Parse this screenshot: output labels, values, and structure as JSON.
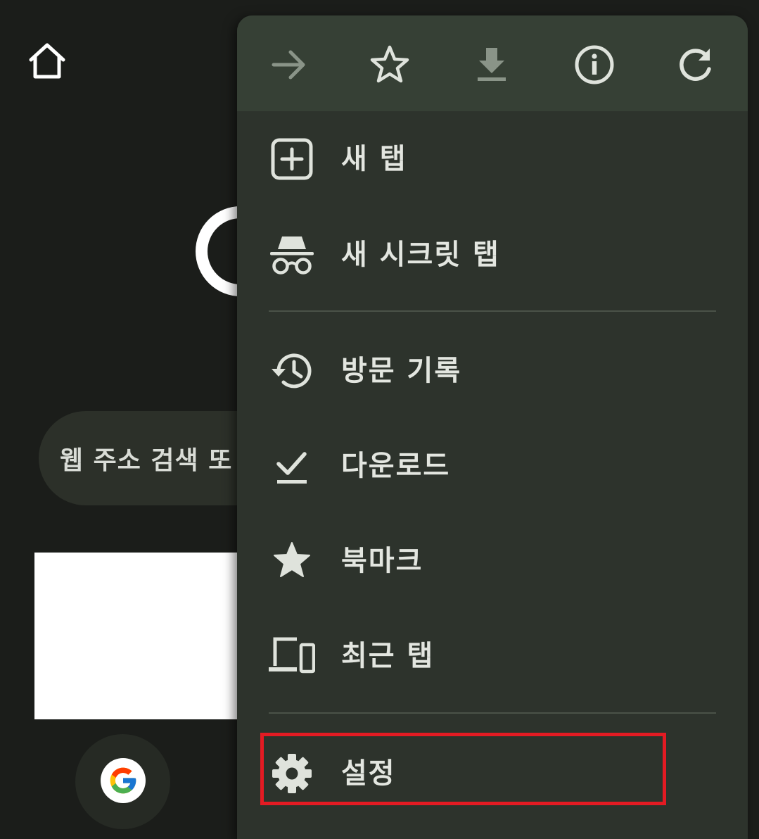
{
  "background": {
    "search_placeholder": "웹 주소 검색 또"
  },
  "toolbar": {
    "buttons": [
      {
        "name": "forward",
        "icon": "arrow-forward-icon",
        "enabled": false
      },
      {
        "name": "bookmark",
        "icon": "star-outline-icon",
        "enabled": true
      },
      {
        "name": "download",
        "icon": "download-icon",
        "enabled": false
      },
      {
        "name": "page-info",
        "icon": "info-icon",
        "enabled": true
      },
      {
        "name": "refresh",
        "icon": "refresh-icon",
        "enabled": true
      }
    ]
  },
  "menu": {
    "items": [
      {
        "label": "새 탭",
        "icon": "new-tab-icon"
      },
      {
        "label": "새 시크릿 탭",
        "icon": "incognito-icon"
      },
      {
        "label": "방문 기록",
        "icon": "history-icon"
      },
      {
        "label": "다운로드",
        "icon": "downloads-check-icon"
      },
      {
        "label": "북마크",
        "icon": "star-filled-icon"
      },
      {
        "label": "최근 탭",
        "icon": "devices-icon"
      },
      {
        "label": "설정",
        "icon": "gear-icon"
      }
    ],
    "highlighted_item": "설정"
  },
  "colors": {
    "page_background": "#1b1d1a",
    "menu_background": "#2d332c",
    "toolbar_background": "#364035",
    "text": "#e3e6e0",
    "icon": "#dfe3dc",
    "disabled_icon": "#8a9488",
    "highlight_border": "#e31b23"
  }
}
